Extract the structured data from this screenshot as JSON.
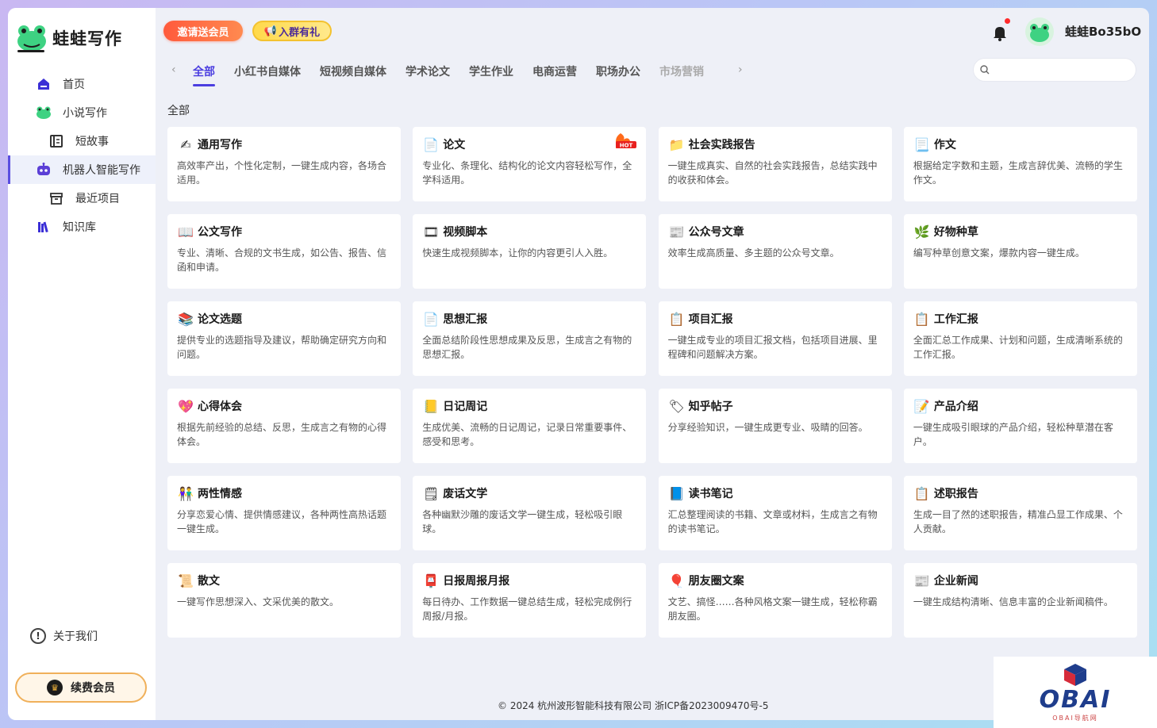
{
  "app": {
    "name": "蛙蛙写作"
  },
  "sidebar": {
    "items": [
      {
        "label": "首页",
        "icon": "home-icon"
      },
      {
        "label": "小说写作",
        "icon": "frog-icon"
      },
      {
        "label": "短故事",
        "icon": "doc-list-icon"
      },
      {
        "label": "机器人智能写作",
        "icon": "robot-icon"
      },
      {
        "label": "最近项目",
        "icon": "box-icon"
      },
      {
        "label": "知识库",
        "icon": "books-icon"
      }
    ],
    "about": "关于我们",
    "renew": "续费会员"
  },
  "header": {
    "promo_invite": "邀请送会员",
    "promo_group": "入群有礼",
    "username": "蛙蛙Bo35bO"
  },
  "tabs": [
    "全部",
    "小红书自媒体",
    "短视频自媒体",
    "学术论文",
    "学生作业",
    "电商运营",
    "职场办公",
    "市场营销"
  ],
  "search": {
    "placeholder": ""
  },
  "section_title": "全部",
  "cards": [
    {
      "title": "通用写作",
      "desc": "高效率产出，个性化定制，一键生成内容，各场合适用。",
      "icon": "pen-icon"
    },
    {
      "title": "论文",
      "desc": "专业化、条理化、结构化的论文内容轻松写作，全学科适用。",
      "icon": "paper-icon",
      "badge": "HOT"
    },
    {
      "title": "社会实践报告",
      "desc": "一键生成真实、自然的社会实践报告，总结实践中的收获和体会。",
      "icon": "folder-icon"
    },
    {
      "title": "作文",
      "desc": "根据给定字数和主题，生成言辞优美、流畅的学生作文。",
      "icon": "page-icon"
    },
    {
      "title": "公文写作",
      "desc": "专业、清晰、合规的文书生成，如公告、报告、信函和申请。",
      "icon": "open-book-icon"
    },
    {
      "title": "视频脚本",
      "desc": "快速生成视频脚本，让你的内容更引人入胜。",
      "icon": "film-icon"
    },
    {
      "title": "公众号文章",
      "desc": "效率生成高质量、多主题的公众号文章。",
      "icon": "newspaper-icon"
    },
    {
      "title": "好物种草",
      "desc": "编写种草创意文案，爆款内容一键生成。",
      "icon": "herb-icon"
    },
    {
      "title": "论文选题",
      "desc": "提供专业的选题指导及建议，帮助确定研究方向和问题。",
      "icon": "stack-books-icon"
    },
    {
      "title": "思想汇报",
      "desc": "全面总结阶段性思想成果及反思，生成言之有物的思想汇报。",
      "icon": "paper-icon"
    },
    {
      "title": "项目汇报",
      "desc": "一键生成专业的项目汇报文档，包括项目进展、里程碑和问题解决方案。",
      "icon": "checklist-icon"
    },
    {
      "title": "工作汇报",
      "desc": "全面汇总工作成果、计划和问题，生成清晰系统的工作汇报。",
      "icon": "clipboard-icon"
    },
    {
      "title": "心得体会",
      "desc": "根据先前经验的总结、反思，生成言之有物的心得体会。",
      "icon": "heart-icon"
    },
    {
      "title": "日记周记",
      "desc": "生成优美、流畅的日记周记，记录日常重要事件、感受和思考。",
      "icon": "notebook-icon"
    },
    {
      "title": "知乎帖子",
      "desc": "分享经验知识，一键生成更专业、吸睛的回答。",
      "icon": "tag-icon"
    },
    {
      "title": "产品介绍",
      "desc": "一键生成吸引眼球的产品介绍，轻松种草潜在客户。",
      "icon": "memo-icon"
    },
    {
      "title": "两性情感",
      "desc": "分享恋爱心情、提供情感建议，各种两性高热话题一键生成。",
      "icon": "couple-icon"
    },
    {
      "title": "废话文学",
      "desc": "各种幽默沙雕的废话文学一键生成，轻松吸引眼球。",
      "icon": "scribble-icon"
    },
    {
      "title": "读书笔记",
      "desc": "汇总整理阅读的书籍、文章或材料，生成言之有物的读书笔记。",
      "icon": "blue-book-icon"
    },
    {
      "title": "述职报告",
      "desc": "生成一目了然的述职报告，精准凸显工作成果、个人贡献。",
      "icon": "checklist-icon"
    },
    {
      "title": "散文",
      "desc": "一键写作思想深入、文采优美的散文。",
      "icon": "scroll-icon"
    },
    {
      "title": "日报周报月报",
      "desc": "每日待办、工作数据一键总结生成，轻松完成例行周报/月报。",
      "icon": "mailbox-icon"
    },
    {
      "title": "朋友圈文案",
      "desc": "文艺、搞怪……各种风格文案一键生成，轻松称霸朋友圈。",
      "icon": "balloon-icon"
    },
    {
      "title": "企业新闻",
      "desc": "一键生成结构清晰、信息丰富的企业新闻稿件。",
      "icon": "newspaper-icon"
    }
  ],
  "footer": "© 2024 杭州波形智能科技有限公司 浙ICP备2023009470号-5",
  "watermark": {
    "text": "OBAI",
    "sub": "OBAI导航网"
  }
}
